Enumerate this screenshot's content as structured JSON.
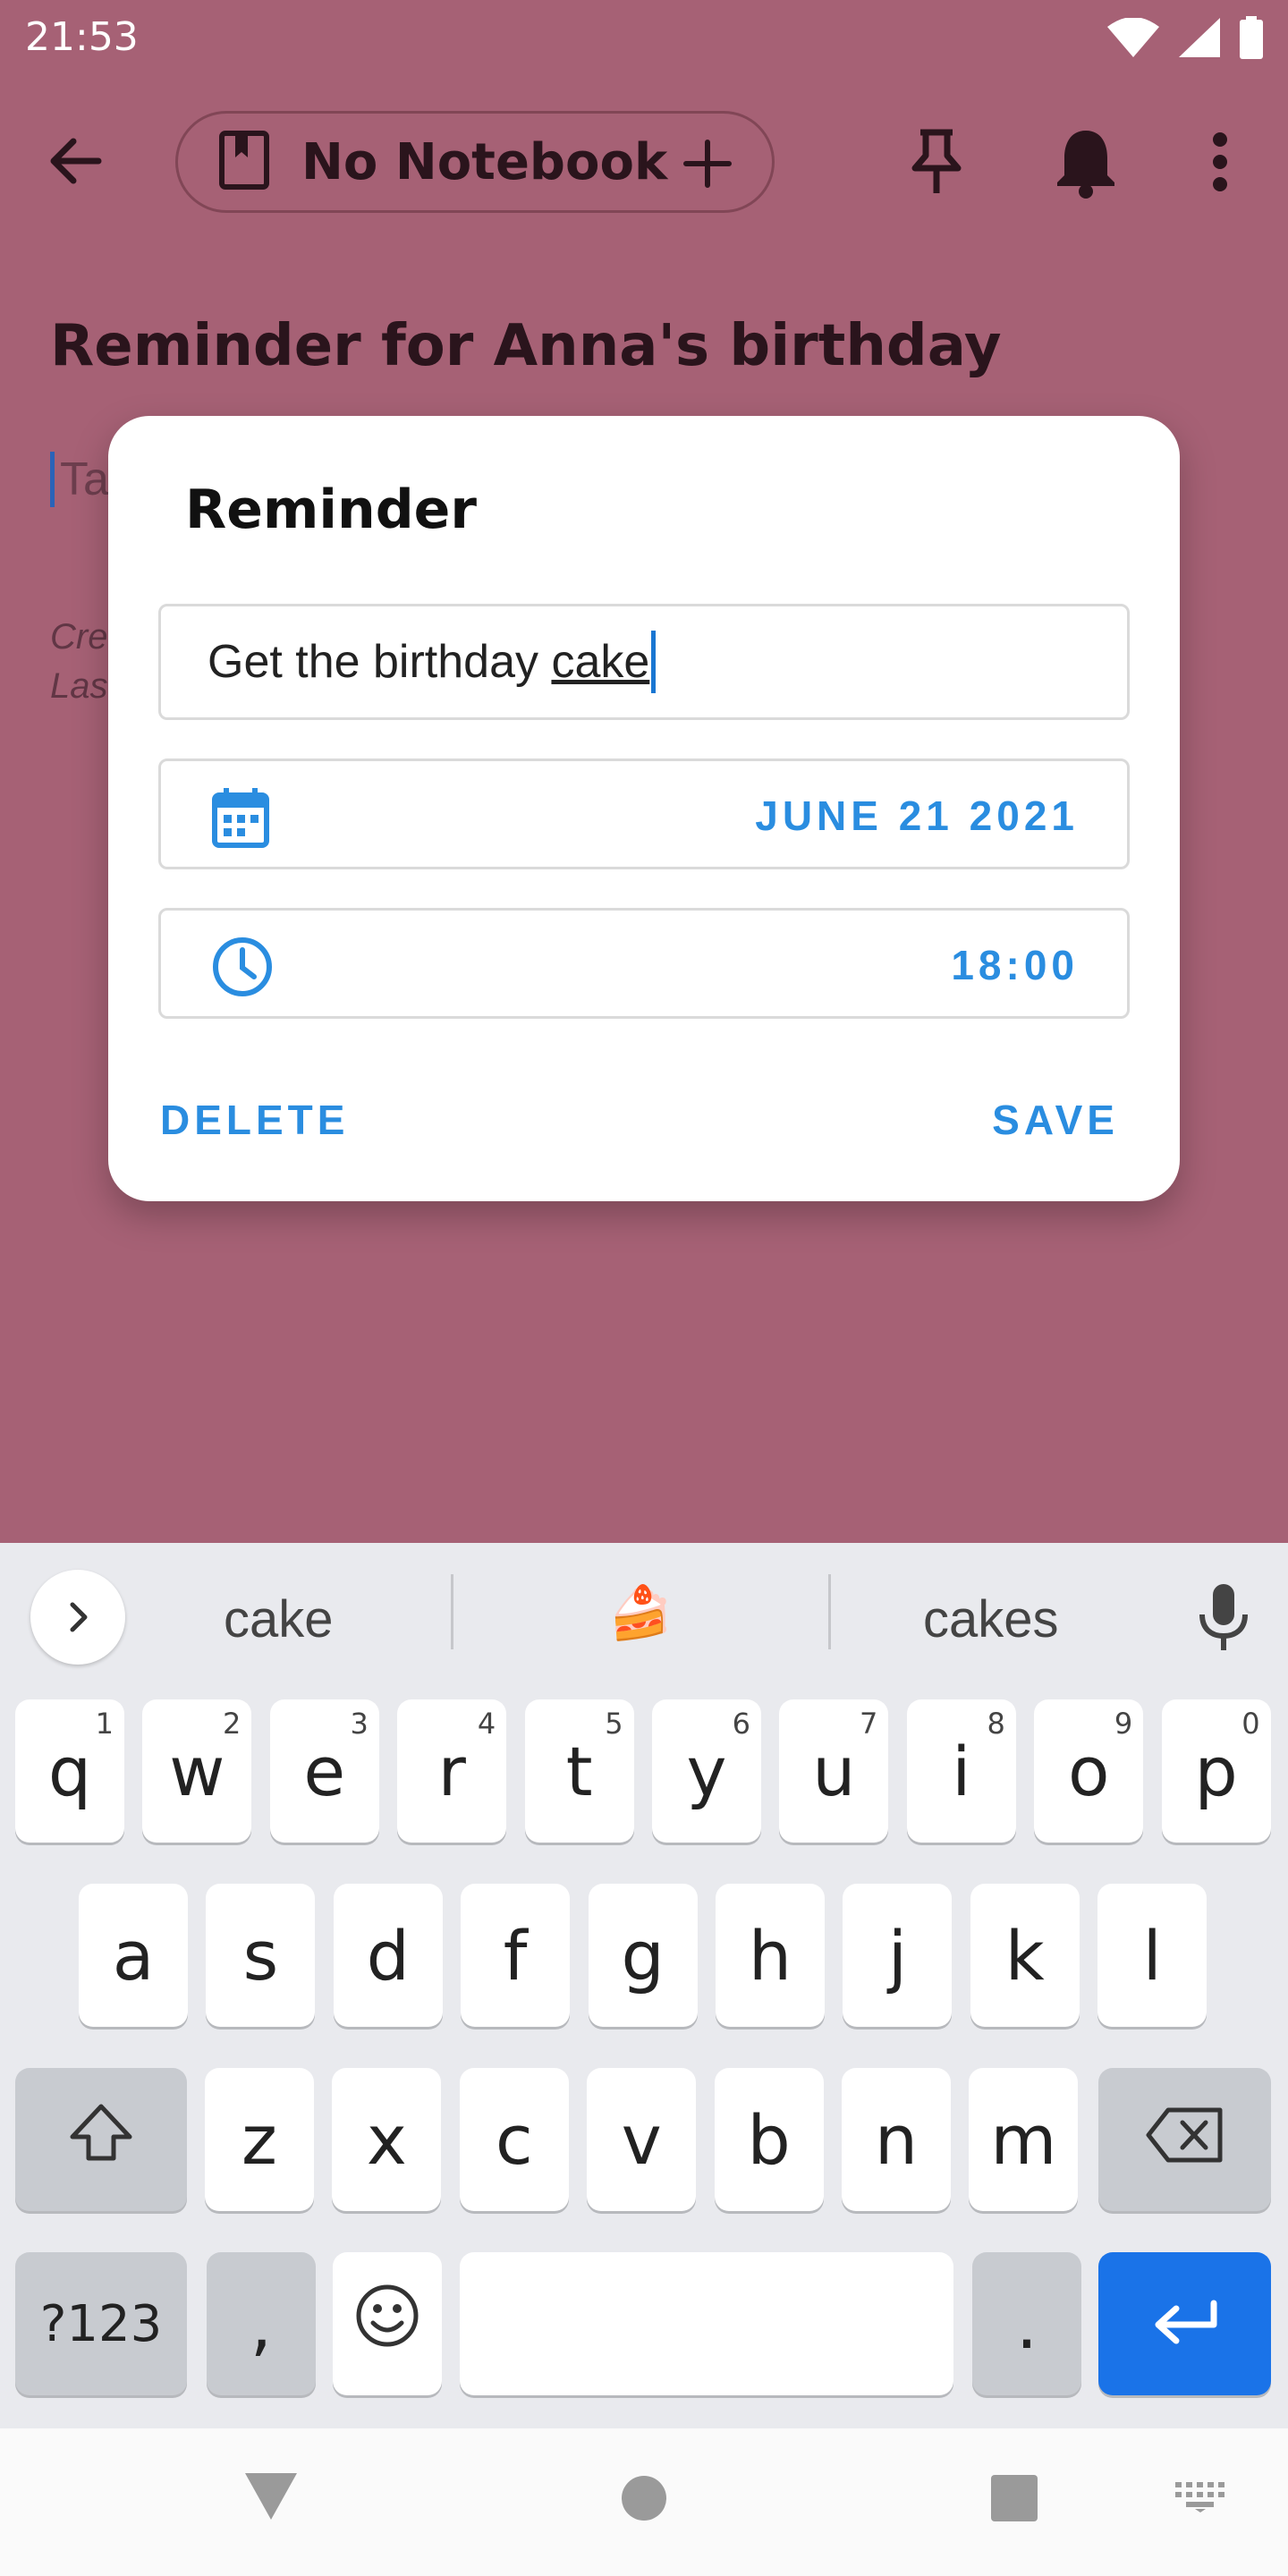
{
  "status_bar": {
    "time": "21:53"
  },
  "app_bar": {
    "notebook_label": "No Notebook"
  },
  "note": {
    "title": "Reminder for Anna's birthday",
    "body_placeholder": "Ta",
    "meta_created": "Cre",
    "meta_last": "Las"
  },
  "dialog": {
    "title": "Reminder",
    "text_value_prefix": "Get the birthday ",
    "text_value_last_word": "cake",
    "date_value": "JUNE 21 2021",
    "time_value": "18:00",
    "delete_label": "DELETE",
    "save_label": "SAVE"
  },
  "keyboard": {
    "suggestions": [
      "cake",
      "🍰",
      "cakes"
    ],
    "row1": [
      {
        "k": "q",
        "h": "1"
      },
      {
        "k": "w",
        "h": "2"
      },
      {
        "k": "e",
        "h": "3"
      },
      {
        "k": "r",
        "h": "4"
      },
      {
        "k": "t",
        "h": "5"
      },
      {
        "k": "y",
        "h": "6"
      },
      {
        "k": "u",
        "h": "7"
      },
      {
        "k": "i",
        "h": "8"
      },
      {
        "k": "o",
        "h": "9"
      },
      {
        "k": "p",
        "h": "0"
      }
    ],
    "row2": [
      "a",
      "s",
      "d",
      "f",
      "g",
      "h",
      "j",
      "k",
      "l"
    ],
    "row3": [
      "z",
      "x",
      "c",
      "v",
      "b",
      "n",
      "m"
    ],
    "symbols_label": "?123",
    "comma_label": ",",
    "period_label": "."
  },
  "colors": {
    "accent": "#2a8de0",
    "scrim_background": "#a66175",
    "enter_key": "#1a73e8"
  },
  "icons": [
    "wifi-icon",
    "signal-icon",
    "battery-icon",
    "back-arrow-icon",
    "notebook-icon",
    "plus-icon",
    "pin-icon",
    "bell-icon",
    "more-vert-icon",
    "calendar-icon",
    "clock-icon",
    "chevron-right-icon",
    "mic-icon",
    "shift-icon",
    "backspace-icon",
    "emoji-icon",
    "enter-icon",
    "nav-back-icon",
    "nav-home-icon",
    "nav-recents-icon",
    "keyboard-switch-icon"
  ]
}
